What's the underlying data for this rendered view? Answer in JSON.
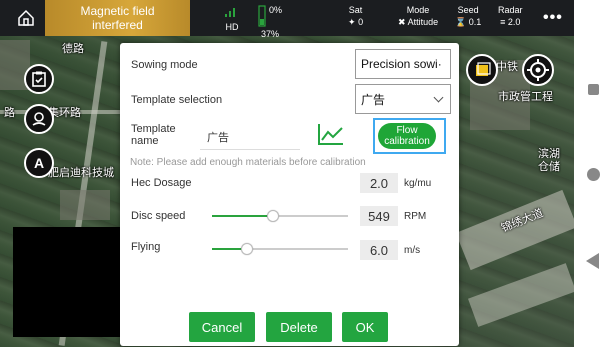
{
  "status_bar": {
    "warning_line1": "Magnetic field",
    "warning_line2": "interfered",
    "signal_label": "HD",
    "battery_percent": "0%",
    "battery_level": "37%",
    "sat_label": "Sat",
    "sat_value": "0",
    "mode_label": "Mode",
    "mode_value": "Attitude",
    "seed_label": "Seed",
    "seed_value": "0.1",
    "radar_label": "Radar",
    "radar_value": "2.0",
    "menu": "•••"
  },
  "map": {
    "label_a": "路",
    "label_b": "德路",
    "label_c": "集环路",
    "label_d": "肥启迪科技城",
    "label_e": "中铁",
    "label_f": "市政管工程",
    "label_g": "滨湖",
    "label_h": "锦绣大道",
    "label_i": "仓储"
  },
  "left_controls": {
    "a_button": "A"
  },
  "dialog": {
    "sowing_mode_label": "Sowing mode",
    "sowing_mode_value": "Precision sowi·",
    "template_selection_label": "Template selection",
    "template_selection_value": "广告",
    "template_name_label": "Template name",
    "template_name_value": "广告",
    "flow_button_label": "Flow calibration",
    "note": "Note: Please add enough materials before calibration",
    "hec_dosage_label": "Hec Dosage",
    "hec_dosage_value": "2.0",
    "hec_dosage_unit": "kg/mu",
    "disc_speed_label": "Disc speed",
    "disc_speed_value": "549",
    "disc_speed_unit": "RPM",
    "disc_speed_fraction": 0.44,
    "flying_speed_label": "Flying speed",
    "flying_speed_value": "6.0",
    "flying_speed_unit": "m/s",
    "flying_speed_fraction": 0.25,
    "cancel": "Cancel",
    "delete": "Delete",
    "ok": "OK"
  },
  "colors": {
    "accent_green": "#23a540",
    "warning_amber": "#d7a73a",
    "highlight_blue": "#3fa9f0"
  }
}
